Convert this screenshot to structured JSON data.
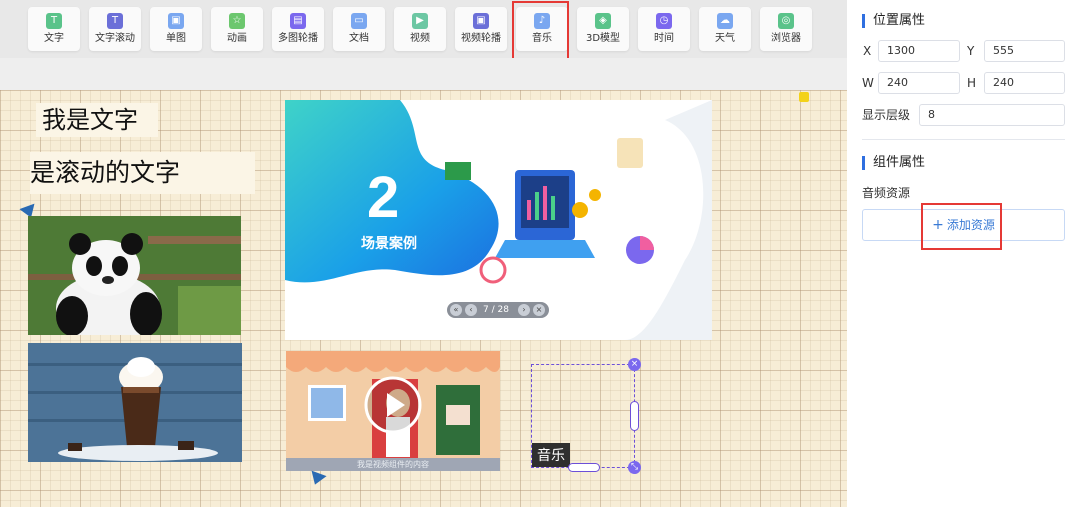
{
  "toolbar": {
    "items": [
      {
        "label": "文字",
        "icon": "text-icon",
        "color": "#5ac38a"
      },
      {
        "label": "文字滚动",
        "icon": "text-scroll-icon",
        "color": "#6b6fd8"
      },
      {
        "label": "单图",
        "icon": "image-icon",
        "color": "#7aa7f0"
      },
      {
        "label": "动画",
        "icon": "animation-icon",
        "color": "#6cc76e"
      },
      {
        "label": "多图轮播",
        "icon": "image-carousel-icon",
        "color": "#7b68ee"
      },
      {
        "label": "文档",
        "icon": "document-icon",
        "color": "#7aa7f0"
      },
      {
        "label": "视频",
        "icon": "video-icon",
        "color": "#6cc7a3"
      },
      {
        "label": "视频轮播",
        "icon": "video-carousel-icon",
        "color": "#6b6fd8"
      },
      {
        "label": "音乐",
        "icon": "music-icon",
        "color": "#7aa7f0"
      },
      {
        "label": "3D模型",
        "icon": "3d-model-icon",
        "color": "#5ac38a"
      },
      {
        "label": "时间",
        "icon": "clock-icon",
        "color": "#7b68ee"
      },
      {
        "label": "天气",
        "icon": "weather-icon",
        "color": "#7aa7f0"
      },
      {
        "label": "浏览器",
        "icon": "browser-icon",
        "color": "#5ac38a"
      }
    ],
    "highlighted": "音乐"
  },
  "canvas": {
    "text1": "我是文字",
    "text2": "是滚动的文字",
    "slide": {
      "number": "2",
      "title": "场景案例",
      "pager": {
        "current": "7",
        "total": "28",
        "separator": "/"
      }
    },
    "video_caption": "我是视频组件的内容",
    "music_label": "音乐"
  },
  "panel": {
    "position_title": "位置属性",
    "x_label": "X",
    "x_value": "1300",
    "y_label": "Y",
    "y_value": "555",
    "w_label": "W",
    "w_value": "240",
    "h_label": "H",
    "h_value": "240",
    "layer_label": "显示层级",
    "layer_value": "8",
    "component_title": "组件属性",
    "audio_label": "音频资源",
    "add_resource": "添加资源"
  },
  "colors": {
    "accent": "#2f6fe0",
    "highlight_box": "#e53935",
    "selection": "#6c4fd8"
  }
}
